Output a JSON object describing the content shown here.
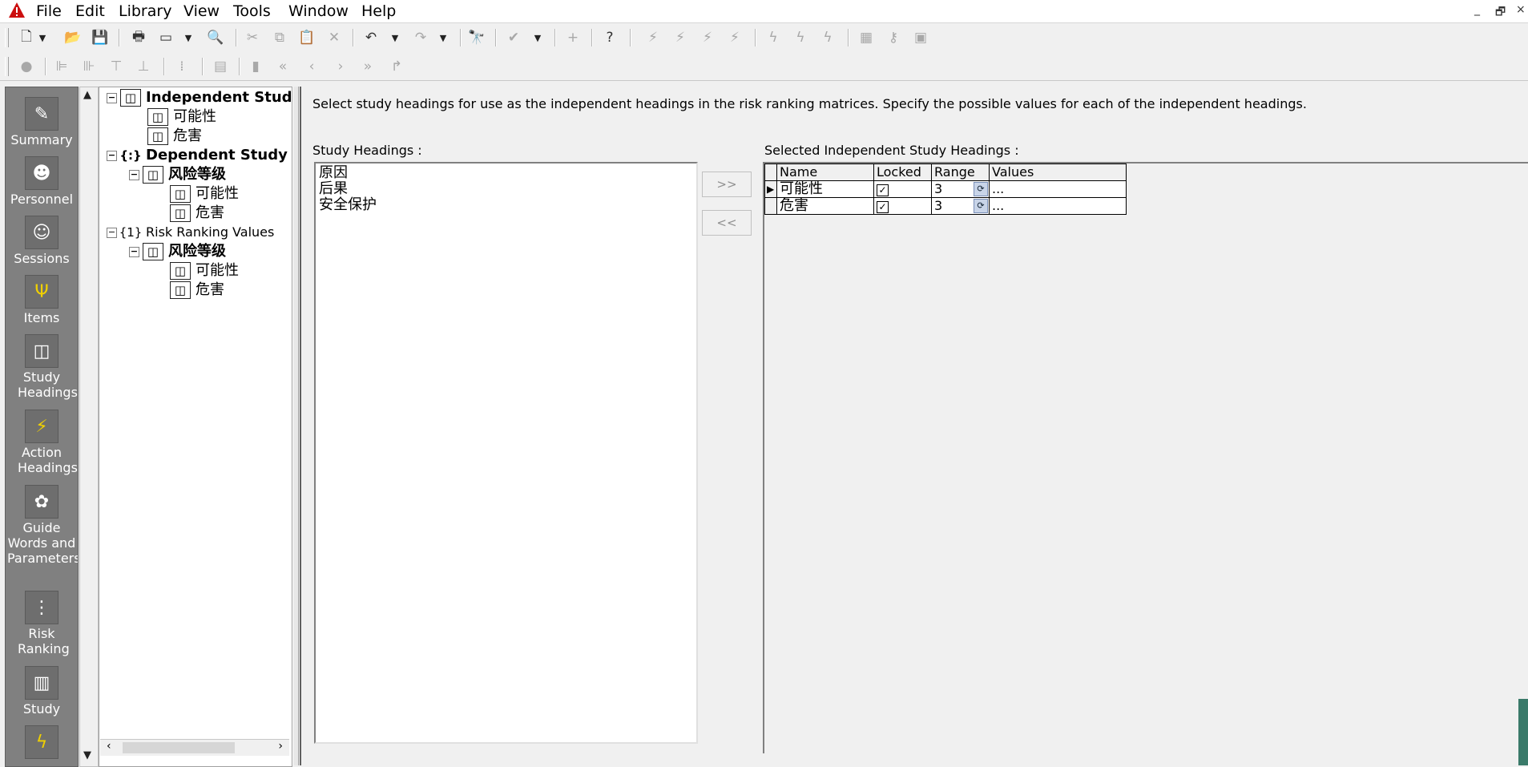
{
  "menubar": {
    "app_icon": "warning-triangle-icon",
    "items": [
      {
        "label": "File"
      },
      {
        "label": "Edit"
      },
      {
        "label": "Library"
      },
      {
        "label": "View"
      },
      {
        "label": "Tools"
      },
      {
        "label": "Window"
      },
      {
        "label": "Help"
      }
    ],
    "window_controls": {
      "minimize": "_",
      "restore": "🗗",
      "close": "×"
    }
  },
  "toolbar1": {
    "buttons": [
      "new-document-icon",
      "open-folder-icon",
      "save-icon",
      "print-icon",
      "page-setup-icon",
      "print-preview-icon",
      "cut-icon",
      "copy-icon",
      "paste-icon",
      "delete-icon",
      "undo-icon",
      "redo-icon",
      "find-icon",
      "spell-check-icon",
      "add-icon",
      "help-icon"
    ]
  },
  "shortcut_bar": {
    "items": [
      {
        "label": "Summary",
        "icon": "summary-icon"
      },
      {
        "label": "Personnel",
        "icon": "personnel-icon"
      },
      {
        "label": "Sessions",
        "icon": "sessions-icon"
      },
      {
        "label": "Items",
        "icon": "items-icon"
      },
      {
        "label": "Study Headings",
        "icon": "study-headings-icon"
      },
      {
        "label": "Action Headings",
        "icon": "action-headings-icon"
      },
      {
        "label": "Guide Words and Parameters",
        "icon": "guide-words-icon"
      },
      {
        "label": "Risk Ranking",
        "icon": "risk-ranking-icon"
      },
      {
        "label": "Study",
        "icon": "study-icon"
      },
      {
        "label": "",
        "icon": "action-icon"
      }
    ]
  },
  "tree": {
    "nodes": [
      {
        "label": "Independent Study H",
        "expander": "⊟"
      },
      {
        "label": "可能性"
      },
      {
        "label": "危害"
      },
      {
        "label": "Dependent Study He",
        "expander": "⊟"
      },
      {
        "label": "风险等级",
        "expander": "⊟"
      },
      {
        "label": "可能性"
      },
      {
        "label": "危害"
      },
      {
        "label": "Risk Ranking Values",
        "expander": "⊟"
      },
      {
        "label": "风险等级",
        "expander": "⊟"
      },
      {
        "label": "可能性"
      },
      {
        "label": "危害"
      }
    ],
    "icon_labels": {
      "braces": "{:}",
      "one": "{1}"
    }
  },
  "main": {
    "instructions": "Select study headings for use as the independent headings in the risk ranking matrices. Specify the possible values for each of the independent headings.",
    "study_headings_label": "Study Headings :",
    "selected_label": "Selected Independent Study Headings :",
    "study_headings": [
      "原因",
      "后果",
      "安全保护"
    ],
    "add_button": ">>",
    "remove_button": "<<",
    "grid": {
      "columns": [
        "Name",
        "Locked",
        "Range",
        "Values"
      ],
      "rows": [
        {
          "indicator": "▶",
          "name": "可能性",
          "locked": "✓",
          "range": "3",
          "values": "..."
        },
        {
          "indicator": "",
          "name": "危害",
          "locked": "✓",
          "range": "3",
          "values": "..."
        }
      ]
    }
  }
}
